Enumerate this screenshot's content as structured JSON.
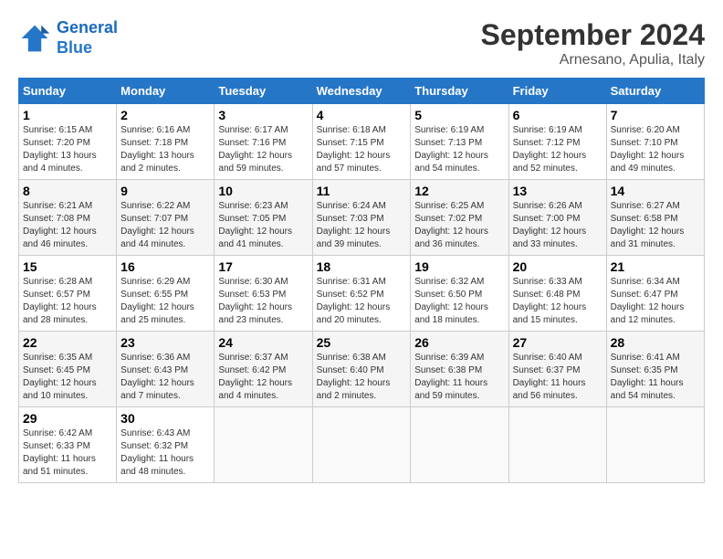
{
  "header": {
    "logo_line1": "General",
    "logo_line2": "Blue",
    "month": "September 2024",
    "location": "Arnesano, Apulia, Italy"
  },
  "columns": [
    "Sunday",
    "Monday",
    "Tuesday",
    "Wednesday",
    "Thursday",
    "Friday",
    "Saturday"
  ],
  "weeks": [
    [
      {
        "day": "1",
        "sunrise": "6:15 AM",
        "sunset": "7:20 PM",
        "daylight": "13 hours and 4 minutes."
      },
      {
        "day": "2",
        "sunrise": "6:16 AM",
        "sunset": "7:18 PM",
        "daylight": "13 hours and 2 minutes."
      },
      {
        "day": "3",
        "sunrise": "6:17 AM",
        "sunset": "7:16 PM",
        "daylight": "12 hours and 59 minutes."
      },
      {
        "day": "4",
        "sunrise": "6:18 AM",
        "sunset": "7:15 PM",
        "daylight": "12 hours and 57 minutes."
      },
      {
        "day": "5",
        "sunrise": "6:19 AM",
        "sunset": "7:13 PM",
        "daylight": "12 hours and 54 minutes."
      },
      {
        "day": "6",
        "sunrise": "6:19 AM",
        "sunset": "7:12 PM",
        "daylight": "12 hours and 52 minutes."
      },
      {
        "day": "7",
        "sunrise": "6:20 AM",
        "sunset": "7:10 PM",
        "daylight": "12 hours and 49 minutes."
      }
    ],
    [
      {
        "day": "8",
        "sunrise": "6:21 AM",
        "sunset": "7:08 PM",
        "daylight": "12 hours and 46 minutes."
      },
      {
        "day": "9",
        "sunrise": "6:22 AM",
        "sunset": "7:07 PM",
        "daylight": "12 hours and 44 minutes."
      },
      {
        "day": "10",
        "sunrise": "6:23 AM",
        "sunset": "7:05 PM",
        "daylight": "12 hours and 41 minutes."
      },
      {
        "day": "11",
        "sunrise": "6:24 AM",
        "sunset": "7:03 PM",
        "daylight": "12 hours and 39 minutes."
      },
      {
        "day": "12",
        "sunrise": "6:25 AM",
        "sunset": "7:02 PM",
        "daylight": "12 hours and 36 minutes."
      },
      {
        "day": "13",
        "sunrise": "6:26 AM",
        "sunset": "7:00 PM",
        "daylight": "12 hours and 33 minutes."
      },
      {
        "day": "14",
        "sunrise": "6:27 AM",
        "sunset": "6:58 PM",
        "daylight": "12 hours and 31 minutes."
      }
    ],
    [
      {
        "day": "15",
        "sunrise": "6:28 AM",
        "sunset": "6:57 PM",
        "daylight": "12 hours and 28 minutes."
      },
      {
        "day": "16",
        "sunrise": "6:29 AM",
        "sunset": "6:55 PM",
        "daylight": "12 hours and 25 minutes."
      },
      {
        "day": "17",
        "sunrise": "6:30 AM",
        "sunset": "6:53 PM",
        "daylight": "12 hours and 23 minutes."
      },
      {
        "day": "18",
        "sunrise": "6:31 AM",
        "sunset": "6:52 PM",
        "daylight": "12 hours and 20 minutes."
      },
      {
        "day": "19",
        "sunrise": "6:32 AM",
        "sunset": "6:50 PM",
        "daylight": "12 hours and 18 minutes."
      },
      {
        "day": "20",
        "sunrise": "6:33 AM",
        "sunset": "6:48 PM",
        "daylight": "12 hours and 15 minutes."
      },
      {
        "day": "21",
        "sunrise": "6:34 AM",
        "sunset": "6:47 PM",
        "daylight": "12 hours and 12 minutes."
      }
    ],
    [
      {
        "day": "22",
        "sunrise": "6:35 AM",
        "sunset": "6:45 PM",
        "daylight": "12 hours and 10 minutes."
      },
      {
        "day": "23",
        "sunrise": "6:36 AM",
        "sunset": "6:43 PM",
        "daylight": "12 hours and 7 minutes."
      },
      {
        "day": "24",
        "sunrise": "6:37 AM",
        "sunset": "6:42 PM",
        "daylight": "12 hours and 4 minutes."
      },
      {
        "day": "25",
        "sunrise": "6:38 AM",
        "sunset": "6:40 PM",
        "daylight": "12 hours and 2 minutes."
      },
      {
        "day": "26",
        "sunrise": "6:39 AM",
        "sunset": "6:38 PM",
        "daylight": "11 hours and 59 minutes."
      },
      {
        "day": "27",
        "sunrise": "6:40 AM",
        "sunset": "6:37 PM",
        "daylight": "11 hours and 56 minutes."
      },
      {
        "day": "28",
        "sunrise": "6:41 AM",
        "sunset": "6:35 PM",
        "daylight": "11 hours and 54 minutes."
      }
    ],
    [
      {
        "day": "29",
        "sunrise": "6:42 AM",
        "sunset": "6:33 PM",
        "daylight": "11 hours and 51 minutes."
      },
      {
        "day": "30",
        "sunrise": "6:43 AM",
        "sunset": "6:32 PM",
        "daylight": "11 hours and 48 minutes."
      },
      null,
      null,
      null,
      null,
      null
    ]
  ],
  "labels": {
    "sunrise": "Sunrise: ",
    "sunset": "Sunset: ",
    "daylight": "Daylight: "
  }
}
